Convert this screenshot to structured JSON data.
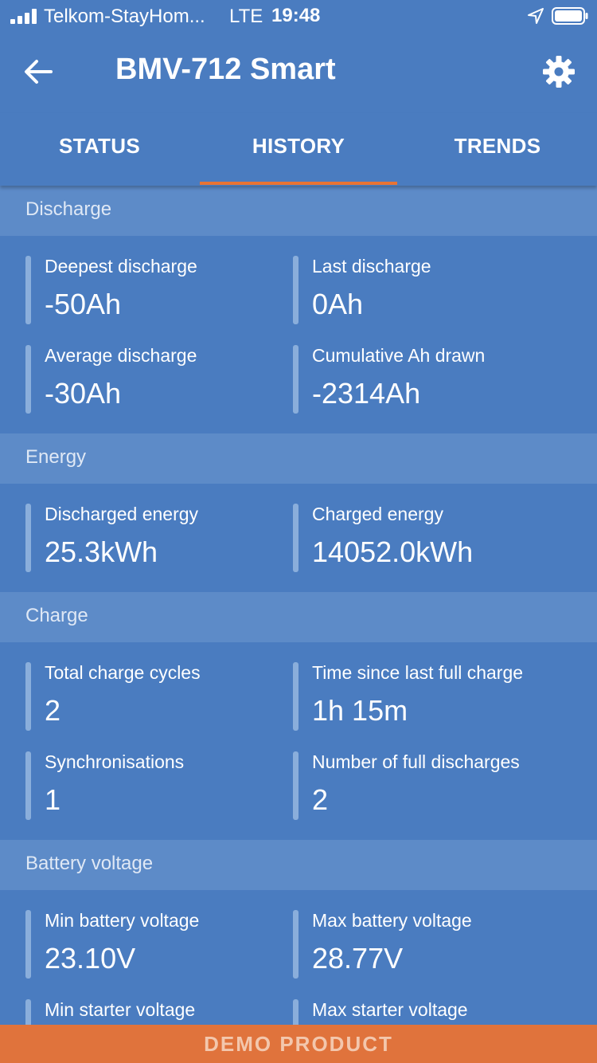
{
  "status_bar": {
    "carrier": "Telkom-StayHom...",
    "network": "LTE",
    "time": "19:48"
  },
  "app_bar": {
    "title": "BMV-712 Smart"
  },
  "tabs": [
    {
      "label": "STATUS",
      "active": false
    },
    {
      "label": "HISTORY",
      "active": true
    },
    {
      "label": "TRENDS",
      "active": false
    }
  ],
  "sections": {
    "discharge": {
      "title": "Discharge",
      "items": [
        {
          "label": "Deepest discharge",
          "value": "-50Ah"
        },
        {
          "label": "Last discharge",
          "value": "0Ah"
        },
        {
          "label": "Average discharge",
          "value": "-30Ah"
        },
        {
          "label": "Cumulative Ah drawn",
          "value": "-2314Ah"
        }
      ]
    },
    "energy": {
      "title": "Energy",
      "items": [
        {
          "label": "Discharged energy",
          "value": "25.3kWh"
        },
        {
          "label": "Charged energy",
          "value": "14052.0kWh"
        }
      ]
    },
    "charge": {
      "title": "Charge",
      "items": [
        {
          "label": "Total charge cycles",
          "value": "2"
        },
        {
          "label": "Time since last full charge",
          "value": "1h 15m"
        },
        {
          "label": "Synchronisations",
          "value": "1"
        },
        {
          "label": "Number of full discharges",
          "value": "2"
        }
      ]
    },
    "battery_voltage": {
      "title": "Battery voltage",
      "items": [
        {
          "label": "Min battery voltage",
          "value": "23.10V"
        },
        {
          "label": "Max battery voltage",
          "value": "28.77V"
        },
        {
          "label": "Min starter voltage",
          "value": ""
        },
        {
          "label": "Max starter voltage",
          "value": ""
        }
      ]
    }
  },
  "demo_banner": "DEMO PRODUCT",
  "colors": {
    "background": "#4a7cc0",
    "section_header": "#5d8bc8",
    "accent": "#e87333",
    "demo_banner": "#e0733c"
  }
}
